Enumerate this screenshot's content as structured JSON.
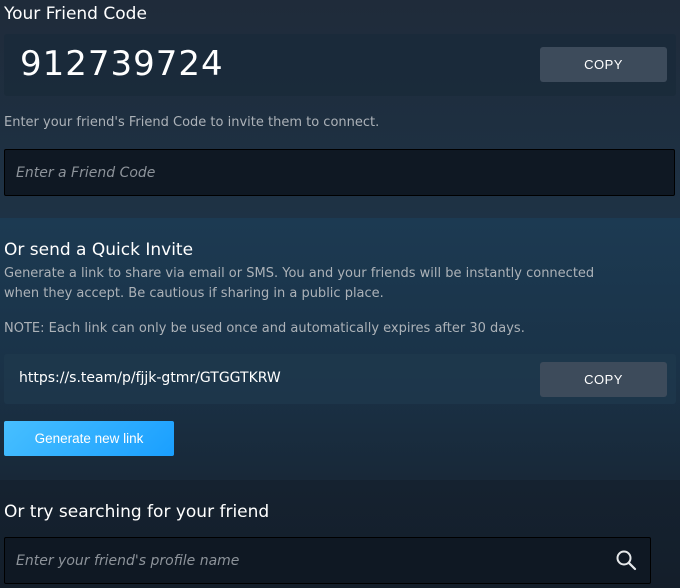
{
  "friend_code_section": {
    "title": "Your Friend Code",
    "code": "912739724",
    "copy_label": "COPY",
    "help_text": "Enter your friend's Friend Code to invite them to connect.",
    "input_placeholder": "Enter a Friend Code"
  },
  "quick_invite_section": {
    "title": "Or send a Quick Invite",
    "description_line1": "Generate a link to share via email or SMS. You and your friends will be instantly connected",
    "description_line2": "when they accept. Be cautious if sharing in a public place.",
    "note": "NOTE: Each link can only be used once and automatically expires after 30 days.",
    "link": "https://s.team/p/fjjk-gtmr/GTGGTKRW",
    "copy_label": "COPY",
    "generate_label": "Generate new link"
  },
  "search_section": {
    "title": "Or try searching for your friend",
    "input_placeholder": "Enter your friend's profile name",
    "icon": "search-icon"
  },
  "colors": {
    "accent_button": "#1a9fff",
    "copy_button": "#3d4b5b",
    "text_primary": "#ffffff",
    "text_secondary": "#acb2b8"
  }
}
